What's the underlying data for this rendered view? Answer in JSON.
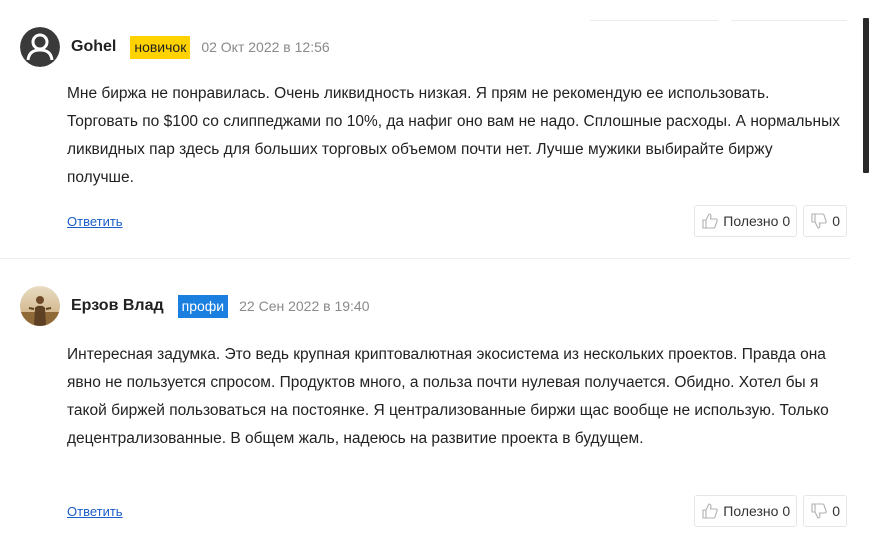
{
  "comments": [
    {
      "author": "Gohel",
      "badge": "новичок",
      "date": "02 Окт 2022 в 12:56",
      "avatar": "default-user-icon",
      "text": "Мне биржа не понравилась. Очень ликвидность низкая. Я прям не рекомендую ее использовать. Торговать по $100 со слиппеджами по 10%, да нафиг оно вам не надо. Сплошные расходы. А нормальных ликвидных пар здесь для больших торговых объемом почти нет. Лучше мужики выбирайте биржу получше.",
      "reply_label": "Ответить",
      "useful_label": "Полезно",
      "useful_count": "0",
      "dislike_count": "0"
    },
    {
      "author": "Ерзов Влад",
      "badge": "профи",
      "date": "22 Сен 2022 в 19:40",
      "avatar": "user-photo",
      "text": "Интересная задумка. Это ведь крупная криптовалютная экосистема из нескольких проектов. Правда она явно не пользуется спросом. Продуктов много, а польза почти нулевая получается. Обидно. Хотел бы я такой биржей пользоваться на постоянке. Я централизованные биржи щас вообще не использую. Только децентрализованные. В общем жаль, надеюсь на развитие проекта в будущем.",
      "reply_label": "Ответить",
      "useful_label": "Полезно",
      "useful_count": "0",
      "dislike_count": "0"
    }
  ],
  "colors": {
    "badge_newbie": "#ffd200",
    "badge_pro": "#1b7fe0",
    "link": "#1a5cc8",
    "date": "#8a8a8a"
  }
}
